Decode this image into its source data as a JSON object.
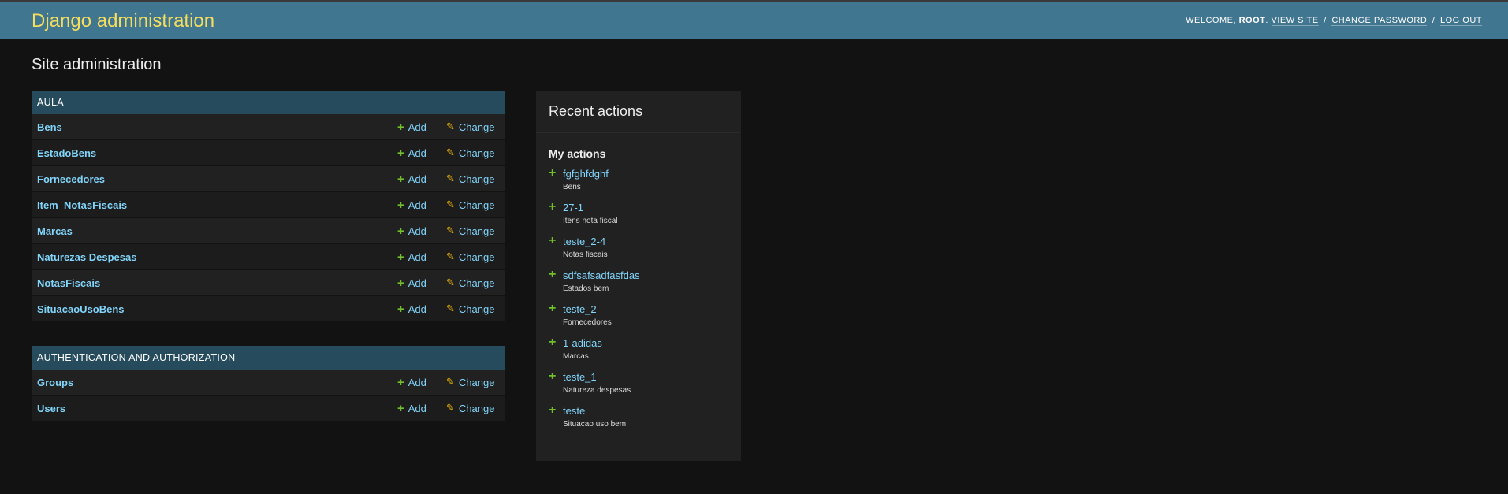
{
  "header": {
    "title": "Django administration",
    "welcome": "WELCOME,",
    "username": "ROOT",
    "view_site": "VIEW SITE",
    "change_password": "CHANGE PASSWORD",
    "log_out": "LOG OUT",
    "separator": "/"
  },
  "page_title": "Site administration",
  "apps": [
    {
      "name": "AULA",
      "models": [
        "Bens",
        "EstadoBens",
        "Fornecedores",
        "Item_NotasFiscais",
        "Marcas",
        "Naturezas Despesas",
        "NotasFiscais",
        "SituacaoUsoBens"
      ]
    },
    {
      "name": "AUTHENTICATION AND AUTHORIZATION",
      "models": [
        "Groups",
        "Users"
      ]
    }
  ],
  "actions": {
    "add": "Add",
    "change": "Change"
  },
  "recent": {
    "title": "Recent actions",
    "my_actions": "My actions",
    "items": [
      {
        "name": "fgfghfdghf",
        "type": "Bens"
      },
      {
        "name": "27-1",
        "type": "Itens nota fiscal"
      },
      {
        "name": "teste_2-4",
        "type": "Notas fiscais"
      },
      {
        "name": "sdfsafsadfasfdas",
        "type": "Estados bem"
      },
      {
        "name": "teste_2",
        "type": "Fornecedores"
      },
      {
        "name": "1-adidas",
        "type": "Marcas"
      },
      {
        "name": "teste_1",
        "type": "Natureza despesas"
      },
      {
        "name": "teste",
        "type": "Situacao uso bem"
      }
    ]
  },
  "colors": {
    "header_bg": "#417690",
    "brand": "#f5dd5d",
    "caption_bg": "#264b5d",
    "link": "#81d4fa",
    "add_icon": "#70bf2b",
    "change_icon": "#efb80b"
  },
  "icons": {
    "add": "plus-icon",
    "change": "pencil-icon"
  }
}
